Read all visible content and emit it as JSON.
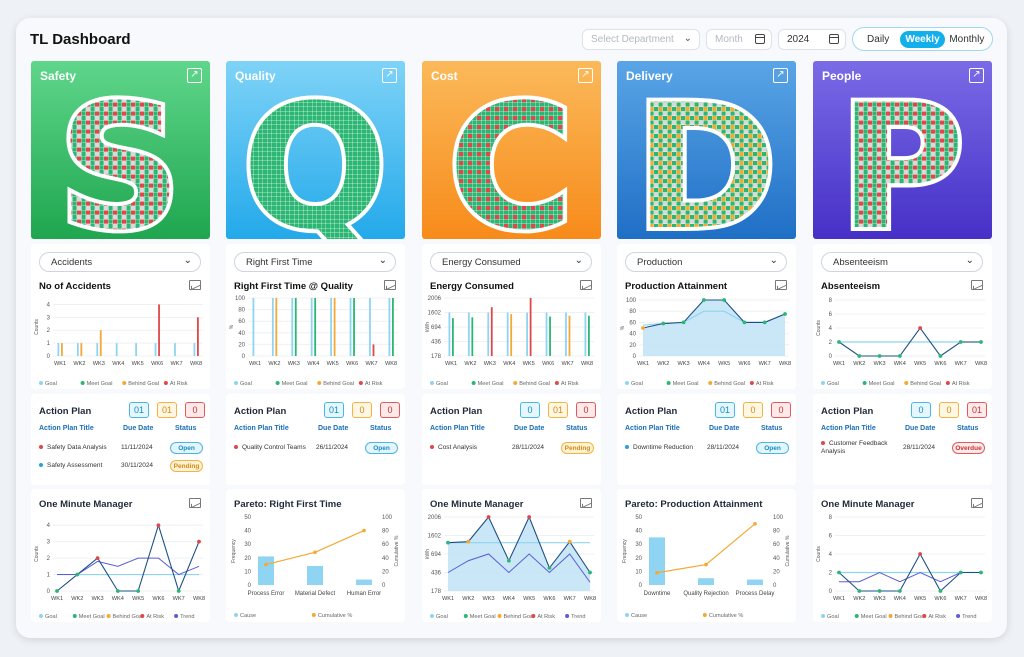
{
  "header": {
    "title": "TL Dashboard",
    "department_placeholder": "Select Department",
    "month_placeholder": "Month",
    "year": "2024",
    "periods": [
      "Daily",
      "Weekly",
      "Monthly"
    ],
    "active_period": "Weekly"
  },
  "weeks": [
    "WK1",
    "WK2",
    "WK3",
    "WK4",
    "WK5",
    "WK6",
    "WK7",
    "WK8"
  ],
  "legend_main": [
    "Goal",
    "Meet Goal",
    "Behind Goal",
    "At Risk"
  ],
  "legend_trend": [
    "Goal",
    "Meet Goal",
    "Behind Goal",
    "At Risk",
    "Trend"
  ],
  "legend_pareto": [
    "Cause",
    "Cumulative %"
  ],
  "colors": {
    "goal": "#8fd4f2",
    "meet": "#2bb673",
    "behind": "#f4a934",
    "risk": "#e04848",
    "trend": "#5b5bd6",
    "title_link": "#1a6fb5"
  },
  "columns": [
    {
      "key": "safety",
      "title": "Safety",
      "letter": "S",
      "banner_colors": [
        "#5fd68b",
        "#1fa64f"
      ],
      "metric_select": "Accidents",
      "chart_title": "No of Accidents",
      "action_plan": {
        "title": "Action Plan",
        "counts": [
          "01",
          "01",
          "0"
        ],
        "headers": [
          "Action Plan Title",
          "Due Date",
          "Status"
        ],
        "rows": [
          {
            "title": "Safety Data Analysis",
            "date": "11/11/2024",
            "status": "Open",
            "dot": "#e04848"
          },
          {
            "title": "Safety Assessment",
            "date": "30/11/2024",
            "status": "Pending",
            "dot": "#2aa0e0"
          }
        ]
      },
      "bottom_title": "One Minute Manager"
    },
    {
      "key": "quality",
      "title": "Quality",
      "letter": "Q",
      "banner_colors": [
        "#7fd3f7",
        "#23a9ea"
      ],
      "metric_select": "Right First Time",
      "chart_title": "Right First Time @ Quality",
      "action_plan": {
        "title": "Action Plan",
        "counts": [
          "01",
          "0",
          "0"
        ],
        "headers": [
          "Action Plan Title",
          "Due Date",
          "Status"
        ],
        "rows": [
          {
            "title": "Quality Control Teams",
            "date": "26/11/2024",
            "status": "Open",
            "dot": "#e04848"
          }
        ]
      },
      "bottom_title": "Pareto: Right First Time"
    },
    {
      "key": "cost",
      "title": "Cost",
      "letter": "C",
      "banner_colors": [
        "#fbb95a",
        "#f78b1a"
      ],
      "metric_select": "Energy Consumed",
      "chart_title": "Energy Consumed",
      "action_plan": {
        "title": "Action Plan",
        "counts": [
          "0",
          "01",
          "0"
        ],
        "headers": [
          "Action Plan Title",
          "Due Date",
          "Status"
        ],
        "rows": [
          {
            "title": "Cost Analysis",
            "date": "28/11/2024",
            "status": "Pending",
            "dot": "#e04848"
          }
        ]
      },
      "bottom_title": "One Minute Manager"
    },
    {
      "key": "delivery",
      "title": "Delivery",
      "letter": "D",
      "banner_colors": [
        "#5aa5e6",
        "#1f6fc6"
      ],
      "metric_select": "Production",
      "chart_title": "Production Attainment",
      "action_plan": {
        "title": "Action Plan",
        "counts": [
          "01",
          "0",
          "0"
        ],
        "headers": [
          "Action Plan Title",
          "Due Date",
          "Status"
        ],
        "rows": [
          {
            "title": "Downtime Reduction",
            "date": "28/11/2024",
            "status": "Open",
            "dot": "#2aa0e0"
          }
        ]
      },
      "bottom_title": "Pareto: Production Attainment"
    },
    {
      "key": "people",
      "title": "People",
      "letter": "P",
      "banner_colors": [
        "#7a6be6",
        "#4630c7"
      ],
      "metric_select": "Absenteeism",
      "chart_title": "Absenteeism",
      "action_plan": {
        "title": "Action Plan",
        "counts": [
          "0",
          "0",
          "01"
        ],
        "headers": [
          "Action Plan Title",
          "Due Date",
          "Status"
        ],
        "rows": [
          {
            "title": "Customer Feedback Analysis",
            "date": "28/11/2024",
            "status": "Overdue",
            "dot": "#e04848"
          }
        ]
      },
      "bottom_title": "One Minute Manager"
    }
  ],
  "chart_data": [
    {
      "id": "safety-accidents",
      "type": "bar",
      "title": "No of Accidents",
      "ylabel": "Counts",
      "categories": [
        "WK1",
        "WK2",
        "WK3",
        "WK4",
        "WK5",
        "WK6",
        "WK7",
        "WK8"
      ],
      "yticks": [
        0,
        1,
        2,
        3,
        4
      ],
      "ylim": [
        0,
        4.5
      ],
      "series": [
        {
          "name": "Goal",
          "values": [
            1,
            1,
            1,
            1,
            1,
            1,
            1,
            1
          ]
        },
        {
          "name": "Behind Goal",
          "values": [
            1,
            1,
            2,
            0,
            0,
            0,
            0,
            0
          ]
        },
        {
          "name": "At Risk",
          "values": [
            0,
            0,
            0,
            0,
            0,
            4,
            0,
            3
          ]
        }
      ]
    },
    {
      "id": "quality-rft",
      "type": "bar",
      "title": "Right First Time @ Quality",
      "ylabel": "%",
      "categories": [
        "WK1",
        "WK2",
        "WK3",
        "WK4",
        "WK5",
        "WK6",
        "WK7",
        "WK8"
      ],
      "yticks": [
        0,
        20,
        40,
        60,
        80,
        100
      ],
      "ylim": [
        0,
        100
      ],
      "series": [
        {
          "name": "Goal",
          "values": [
            100,
            100,
            100,
            100,
            100,
            100,
            100,
            100
          ]
        },
        {
          "name": "Meet Goal",
          "values": [
            0,
            0,
            100,
            100,
            0,
            100,
            0,
            100
          ]
        },
        {
          "name": "Behind Goal",
          "values": [
            0,
            100,
            0,
            0,
            100,
            0,
            0,
            0
          ]
        },
        {
          "name": "At Risk",
          "values": [
            0,
            0,
            0,
            0,
            0,
            0,
            20,
            0
          ]
        }
      ]
    },
    {
      "id": "cost-energy",
      "type": "bar",
      "title": "Energy Consumed",
      "ylabel": "kWh",
      "categories": [
        "WK1",
        "WK2",
        "WK3",
        "WK4",
        "WK5",
        "WK6",
        "WK7",
        "WK8"
      ],
      "yticks": [
        178,
        436,
        694,
        1602,
        2006
      ],
      "ylim": [
        178,
        2006
      ],
      "series": [
        {
          "name": "Goal",
          "values": [
            1602,
            1602,
            1602,
            1602,
            1602,
            1602,
            1602,
            1602
          ]
        },
        {
          "name": "Meet Goal",
          "values": [
            1250,
            1300,
            0,
            0,
            0,
            1350,
            0,
            1400
          ]
        },
        {
          "name": "Behind Goal",
          "values": [
            0,
            0,
            0,
            1500,
            0,
            0,
            1400,
            0
          ]
        },
        {
          "name": "At Risk",
          "values": [
            0,
            0,
            1750,
            0,
            2006,
            0,
            0,
            0
          ]
        }
      ]
    },
    {
      "id": "delivery-production",
      "type": "area",
      "title": "Production Attainment",
      "ylabel": "%",
      "categories": [
        "WK1",
        "WK2",
        "WK3",
        "WK4",
        "WK5",
        "WK6",
        "WK7",
        "WK8"
      ],
      "yticks": [
        0,
        20,
        40,
        60,
        80,
        100
      ],
      "ylim": [
        0,
        100
      ],
      "series": [
        {
          "name": "Goal",
          "values": [
            55,
            58,
            60,
            80,
            80,
            60,
            60,
            75
          ]
        },
        {
          "name": "Actual",
          "values": [
            50,
            58,
            60,
            100,
            100,
            60,
            60,
            75
          ]
        }
      ]
    },
    {
      "id": "people-absenteeism",
      "type": "line",
      "title": "Absenteeism",
      "ylabel": "Counts",
      "categories": [
        "WK1",
        "WK2",
        "WK3",
        "WK4",
        "WK5",
        "WK6",
        "WK7",
        "WK8"
      ],
      "yticks": [
        0,
        2,
        4,
        6,
        8
      ],
      "ylim": [
        0,
        8
      ],
      "series": [
        {
          "name": "Goal",
          "values": [
            2,
            2,
            2,
            2,
            2,
            2,
            2,
            2
          ]
        },
        {
          "name": "Actual",
          "values": [
            2,
            0,
            0,
            0,
            4,
            0,
            2,
            2
          ]
        }
      ]
    },
    {
      "id": "safety-omm",
      "type": "line",
      "title": "One Minute Manager",
      "ylabel": "Counts",
      "categories": [
        "WK1",
        "WK2",
        "WK3",
        "WK4",
        "WK5",
        "WK6",
        "WK7",
        "WK8"
      ],
      "yticks": [
        0,
        1,
        2,
        3,
        4
      ],
      "ylim": [
        0,
        4.5
      ],
      "series": [
        {
          "name": "Goal",
          "values": [
            1,
            1,
            1,
            1,
            1,
            1,
            1,
            1
          ]
        },
        {
          "name": "Actual",
          "values": [
            0,
            1,
            2,
            0,
            0,
            4,
            0,
            3
          ]
        },
        {
          "name": "Trend",
          "values": [
            1,
            1,
            1.8,
            1.5,
            2,
            2,
            1,
            1.5
          ]
        }
      ]
    },
    {
      "id": "quality-pareto",
      "type": "bar",
      "title": "Pareto: Right First Time",
      "ylabel": "Frequency",
      "y2label": "Cumulative %",
      "categories": [
        "Process Error",
        "Material Defect",
        "Human Error"
      ],
      "yticks": [
        0,
        10,
        20,
        30,
        40,
        50
      ],
      "y2ticks": [
        0,
        20,
        40,
        60,
        80,
        100
      ],
      "series": [
        {
          "name": "Cause",
          "values": [
            21,
            14,
            4
          ]
        },
        {
          "name": "Cumulative %",
          "values": [
            30,
            48,
            80
          ]
        }
      ]
    },
    {
      "id": "cost-omm",
      "type": "area",
      "title": "One Minute Manager",
      "ylabel": "kWh",
      "categories": [
        "WK1",
        "WK2",
        "WK3",
        "WK4",
        "WK5",
        "WK6",
        "WK7",
        "WK8"
      ],
      "yticks": [
        178,
        436,
        694,
        1602,
        2006
      ],
      "ylim": [
        178,
        2006
      ],
      "series": [
        {
          "name": "Goal",
          "values": [
            1250,
            1250,
            1250,
            1250,
            1250,
            1250,
            1250,
            1250
          ]
        },
        {
          "name": "Actual",
          "values": [
            1250,
            1300,
            2006,
            600,
            2006,
            500,
            1300,
            436
          ]
        },
        {
          "name": "Trend",
          "values": [
            436,
            600,
            694,
            436,
            694,
            436,
            694,
            300
          ]
        }
      ]
    },
    {
      "id": "delivery-pareto",
      "type": "bar",
      "title": "Pareto: Production Attainment",
      "ylabel": "Frequency",
      "y2label": "Cumulative %",
      "categories": [
        "Downtime",
        "Quality Rejection",
        "Process Delay"
      ],
      "yticks": [
        0,
        10,
        20,
        30,
        40,
        50
      ],
      "y2ticks": [
        0,
        20,
        40,
        60,
        80,
        100
      ],
      "series": [
        {
          "name": "Cause",
          "values": [
            35,
            5,
            4
          ]
        },
        {
          "name": "Cumulative %",
          "values": [
            18,
            30,
            90
          ]
        }
      ]
    },
    {
      "id": "people-omm",
      "type": "line",
      "title": "One Minute Manager",
      "ylabel": "Counts",
      "categories": [
        "WK1",
        "WK2",
        "WK3",
        "WK4",
        "WK5",
        "WK6",
        "WK7",
        "WK8"
      ],
      "yticks": [
        0,
        2,
        4,
        6,
        8
      ],
      "ylim": [
        0,
        8
      ],
      "series": [
        {
          "name": "Goal",
          "values": [
            2,
            2,
            2,
            2,
            2,
            2,
            2,
            2
          ]
        },
        {
          "name": "Actual",
          "values": [
            2,
            0,
            0,
            0,
            4,
            0,
            2,
            2
          ]
        },
        {
          "name": "Trend",
          "values": [
            1,
            1,
            2,
            1,
            2,
            1,
            2,
            2
          ]
        }
      ]
    }
  ]
}
